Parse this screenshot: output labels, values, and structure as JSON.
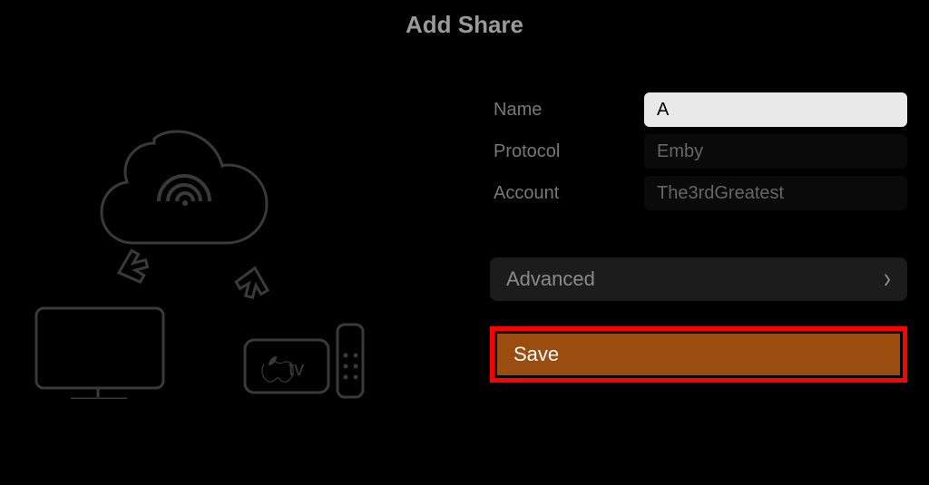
{
  "header": {
    "title": "Add Share"
  },
  "form": {
    "name_label": "Name",
    "name_value": "A",
    "protocol_label": "Protocol",
    "protocol_value": "Emby",
    "account_label": "Account",
    "account_value": "The3rdGreatest",
    "advanced_label": "Advanced",
    "save_label": "Save"
  }
}
